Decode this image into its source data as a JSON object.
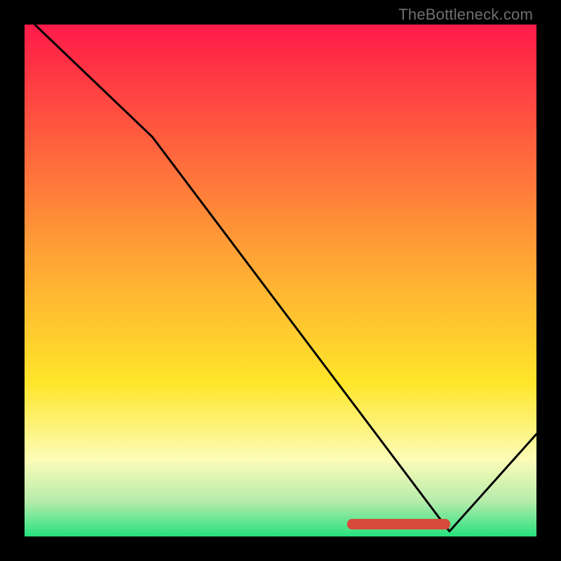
{
  "watermark": "TheBottleneck.com",
  "colors": {
    "gradient_top": "#ff1b4b",
    "gradient_peak": "#ff2c45",
    "gradient_orange": "#ffa335",
    "gradient_yellow": "#ffe62a",
    "gradient_pale": "#fcfcb7",
    "gradient_palegreen": "#b8ecac",
    "gradient_green": "#27e17e",
    "line": "#000000",
    "frame": "#000000",
    "legend_blob": "#d84b3a"
  },
  "chart_data": {
    "type": "line",
    "title": "",
    "xlabel": "",
    "ylabel": "",
    "xlim": [
      0,
      100
    ],
    "ylim": [
      0,
      100
    ],
    "x": [
      2,
      25,
      83,
      100
    ],
    "values": [
      100,
      78,
      1,
      20
    ],
    "notes": "Background is a vertical red→yellow→green gradient; a single black line descends steeply, reaches ~1 near x≈83, then rises toward the right edge. A small red rounded marker sits on the baseline near the trough.",
    "legend_blob": {
      "x_percent": 73,
      "y_percent": 97.5
    }
  }
}
